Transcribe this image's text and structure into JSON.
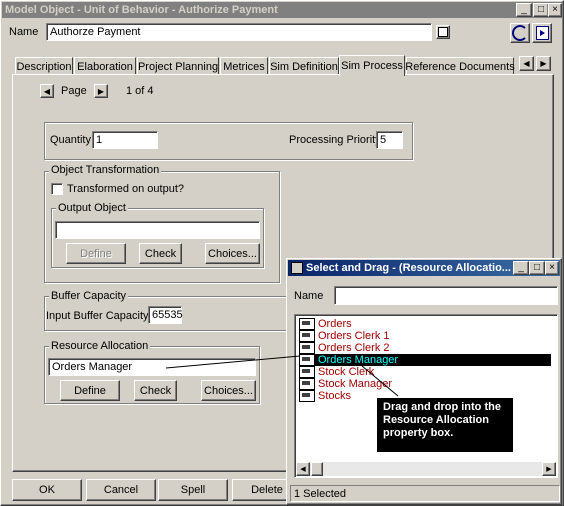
{
  "main_window": {
    "title": "Model Object - Unit of Behavior - Authorize Payment",
    "name_label": "Name",
    "name_value": "Authorze Payment",
    "tabs": [
      "Description",
      "Elaboration",
      "Project Planning",
      "Metrices",
      "Sim Definition",
      "Sim Process",
      "Reference Documents"
    ],
    "active_tab": "Sim Process",
    "page_label": "Page",
    "page_info": "1 of 4",
    "quantity_label": "Quantity",
    "quantity_value": "1",
    "priority_label": "Processing Priority",
    "priority_value": "5",
    "transformation_title": "Object Transformation",
    "transformed_label": "Transformed on output?",
    "output_object_title": "Output Object",
    "output_object_value": "",
    "define_label": "Define",
    "check_label": "Check",
    "choices_label": "Choices...",
    "buffer_title": "Buffer Capacity",
    "input_buffer_label": "Input Buffer Capacity",
    "input_buffer_value": "65535",
    "resource_title": "Resource Allocation",
    "resource_value": "Orders Manager",
    "res_define_label": "Define",
    "res_check_label": "Check",
    "res_choices_label": "Choices...",
    "bottom_buttons": [
      "OK",
      "Cancel",
      "Spell",
      "Delete"
    ]
  },
  "popup": {
    "title": "Select and Drag - (Resource Allocatio...",
    "name_label": "Name",
    "name_value": "",
    "items": [
      "Orders",
      "Orders Clerk 1",
      "Orders Clerk 2",
      "Orders Manager",
      "Stock Clerk",
      "Stock Manager",
      "Stocks"
    ],
    "selected_item": "Orders Manager",
    "status": "1 Selected"
  },
  "callout": "Drag and drop into the Resource Allocation property box."
}
